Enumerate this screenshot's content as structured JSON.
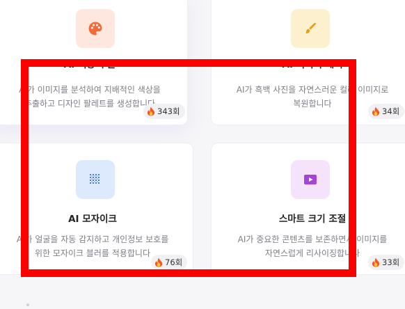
{
  "cards": [
    {
      "title": "AI 색상 추출",
      "desc_line1": "AI가 이미지를 분석하여 지배적인 색상을",
      "desc_line2": "추출하고 디자인 팔레트를 생성합니다",
      "count": "343회",
      "icon": "palette-icon",
      "icon_color": "#f26b3a"
    },
    {
      "title": "AI 이미지 채색",
      "desc_line1": "AI가 흑백 사진을 자연스러운 컬러 이미지로",
      "desc_line2": "복원합니다",
      "count": "34회",
      "icon": "paintbrush-icon",
      "icon_color": "#e8a015"
    },
    {
      "title": "AI 모자이크",
      "desc_line1": "AI가 얼굴을 자동 감지하고 개인정보 보호를",
      "desc_line2": "위한 모자이크 블러를 적용합니다",
      "count": "76회",
      "icon": "mosaic-grid-icon",
      "icon_color": "#4a7de8"
    },
    {
      "title": "스마트 크기 조절",
      "desc_line1": "AI가 중요한 콘텐츠를 보존하면서 이미지를",
      "desc_line2": "자연스럽게 리사이징합니다",
      "count": "33회",
      "icon": "play-video-icon",
      "icon_color": "#a545d6"
    }
  ],
  "highlight_color": "#ff0000",
  "badge_icon": "fire-icon"
}
